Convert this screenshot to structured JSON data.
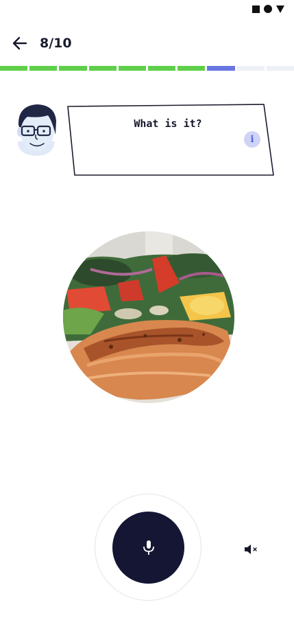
{
  "header": {
    "progress_label": "8/10"
  },
  "progress": {
    "current": 8,
    "total": 10,
    "segments": [
      "done",
      "done",
      "done",
      "done",
      "done",
      "done",
      "done",
      "current",
      "todo",
      "todo"
    ],
    "colors": {
      "done": "#5fcf4a",
      "current": "#6877e1",
      "todo": "#eef0f7"
    }
  },
  "prompt": {
    "question": "What is it?",
    "info_glyph": "i"
  },
  "icons": {
    "back": "arrow-left-icon",
    "info": "info-icon",
    "mic": "microphone-icon",
    "mute": "speaker-muted-icon"
  },
  "colors": {
    "mic_button": "#141634",
    "accent": "#6877e1"
  }
}
